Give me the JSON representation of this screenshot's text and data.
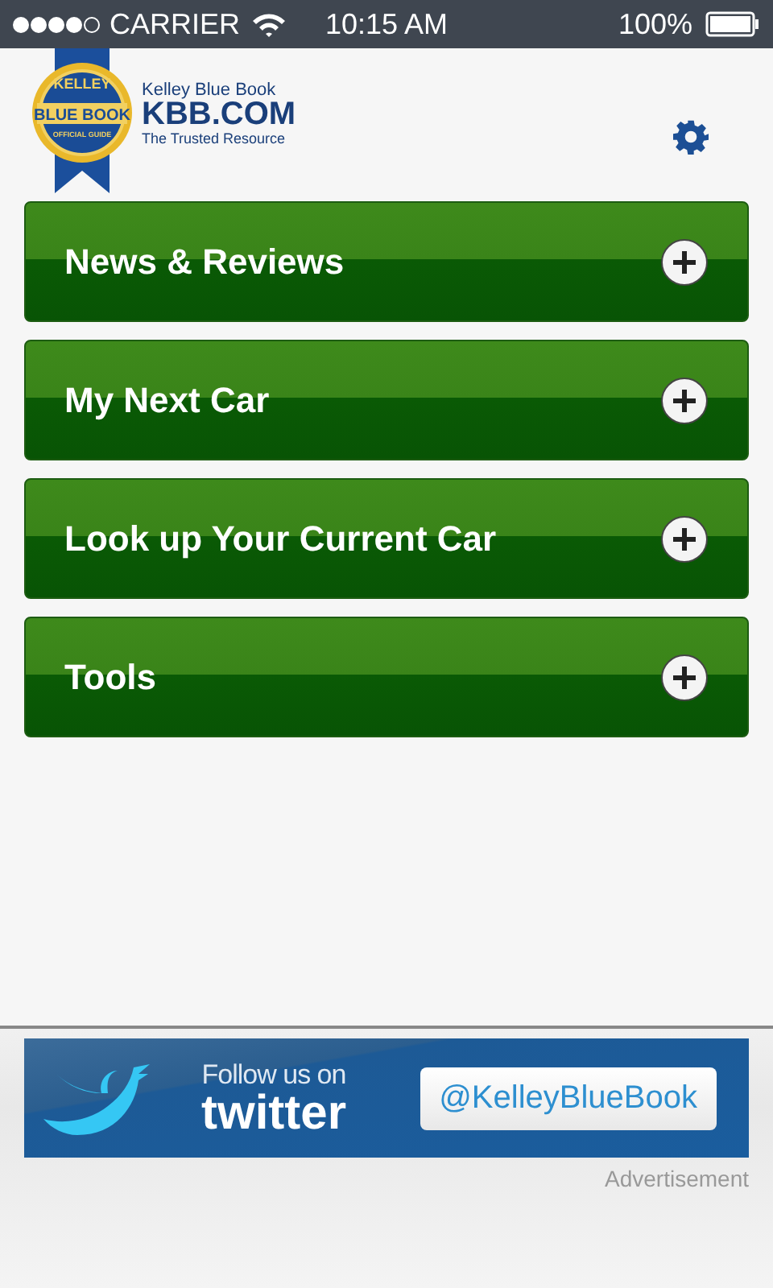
{
  "status_bar": {
    "carrier": "CARRIER",
    "time": "10:15 AM",
    "battery": "100%"
  },
  "logo": {
    "badge_top": "KELLEY",
    "badge_middle": "BLUE BOOK",
    "badge_bottom": "OFFICIAL GUIDE",
    "name": "Kelley Blue Book",
    "domain": "KBB.COM",
    "tagline": "The Trusted Resource"
  },
  "menu": [
    {
      "label": "News & Reviews",
      "expanded": false
    },
    {
      "label": "My Next Car",
      "expanded": false
    },
    {
      "label": "Look up Your Current Car",
      "expanded": false
    },
    {
      "label": "Tools",
      "expanded": false
    }
  ],
  "ad": {
    "follow": "Follow us on",
    "brand": "twitter",
    "handle": "@KelleyBlueBook",
    "caption": "Advertisement"
  }
}
